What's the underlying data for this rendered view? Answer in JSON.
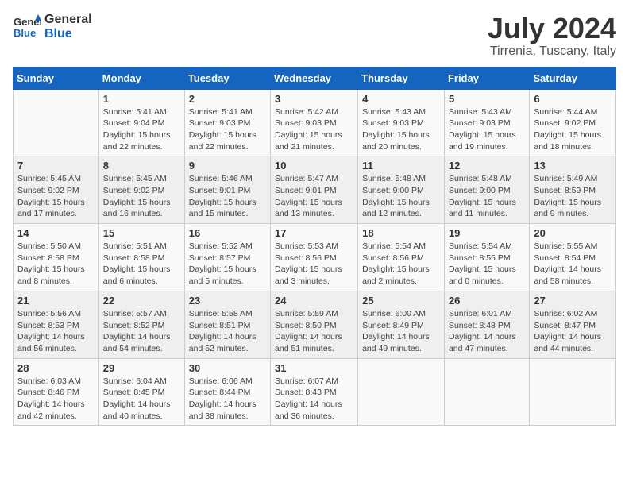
{
  "header": {
    "logo_general": "General",
    "logo_blue": "Blue",
    "month_year": "July 2024",
    "location": "Tirrenia, Tuscany, Italy"
  },
  "calendar": {
    "weekdays": [
      "Sunday",
      "Monday",
      "Tuesday",
      "Wednesday",
      "Thursday",
      "Friday",
      "Saturday"
    ],
    "weeks": [
      [
        {
          "day": "",
          "detail": ""
        },
        {
          "day": "1",
          "detail": "Sunrise: 5:41 AM\nSunset: 9:04 PM\nDaylight: 15 hours\nand 22 minutes."
        },
        {
          "day": "2",
          "detail": "Sunrise: 5:41 AM\nSunset: 9:03 PM\nDaylight: 15 hours\nand 22 minutes."
        },
        {
          "day": "3",
          "detail": "Sunrise: 5:42 AM\nSunset: 9:03 PM\nDaylight: 15 hours\nand 21 minutes."
        },
        {
          "day": "4",
          "detail": "Sunrise: 5:43 AM\nSunset: 9:03 PM\nDaylight: 15 hours\nand 20 minutes."
        },
        {
          "day": "5",
          "detail": "Sunrise: 5:43 AM\nSunset: 9:03 PM\nDaylight: 15 hours\nand 19 minutes."
        },
        {
          "day": "6",
          "detail": "Sunrise: 5:44 AM\nSunset: 9:02 PM\nDaylight: 15 hours\nand 18 minutes."
        }
      ],
      [
        {
          "day": "7",
          "detail": "Sunrise: 5:45 AM\nSunset: 9:02 PM\nDaylight: 15 hours\nand 17 minutes."
        },
        {
          "day": "8",
          "detail": "Sunrise: 5:45 AM\nSunset: 9:02 PM\nDaylight: 15 hours\nand 16 minutes."
        },
        {
          "day": "9",
          "detail": "Sunrise: 5:46 AM\nSunset: 9:01 PM\nDaylight: 15 hours\nand 15 minutes."
        },
        {
          "day": "10",
          "detail": "Sunrise: 5:47 AM\nSunset: 9:01 PM\nDaylight: 15 hours\nand 13 minutes."
        },
        {
          "day": "11",
          "detail": "Sunrise: 5:48 AM\nSunset: 9:00 PM\nDaylight: 15 hours\nand 12 minutes."
        },
        {
          "day": "12",
          "detail": "Sunrise: 5:48 AM\nSunset: 9:00 PM\nDaylight: 15 hours\nand 11 minutes."
        },
        {
          "day": "13",
          "detail": "Sunrise: 5:49 AM\nSunset: 8:59 PM\nDaylight: 15 hours\nand 9 minutes."
        }
      ],
      [
        {
          "day": "14",
          "detail": "Sunrise: 5:50 AM\nSunset: 8:58 PM\nDaylight: 15 hours\nand 8 minutes."
        },
        {
          "day": "15",
          "detail": "Sunrise: 5:51 AM\nSunset: 8:58 PM\nDaylight: 15 hours\nand 6 minutes."
        },
        {
          "day": "16",
          "detail": "Sunrise: 5:52 AM\nSunset: 8:57 PM\nDaylight: 15 hours\nand 5 minutes."
        },
        {
          "day": "17",
          "detail": "Sunrise: 5:53 AM\nSunset: 8:56 PM\nDaylight: 15 hours\nand 3 minutes."
        },
        {
          "day": "18",
          "detail": "Sunrise: 5:54 AM\nSunset: 8:56 PM\nDaylight: 15 hours\nand 2 minutes."
        },
        {
          "day": "19",
          "detail": "Sunrise: 5:54 AM\nSunset: 8:55 PM\nDaylight: 15 hours\nand 0 minutes."
        },
        {
          "day": "20",
          "detail": "Sunrise: 5:55 AM\nSunset: 8:54 PM\nDaylight: 14 hours\nand 58 minutes."
        }
      ],
      [
        {
          "day": "21",
          "detail": "Sunrise: 5:56 AM\nSunset: 8:53 PM\nDaylight: 14 hours\nand 56 minutes."
        },
        {
          "day": "22",
          "detail": "Sunrise: 5:57 AM\nSunset: 8:52 PM\nDaylight: 14 hours\nand 54 minutes."
        },
        {
          "day": "23",
          "detail": "Sunrise: 5:58 AM\nSunset: 8:51 PM\nDaylight: 14 hours\nand 52 minutes."
        },
        {
          "day": "24",
          "detail": "Sunrise: 5:59 AM\nSunset: 8:50 PM\nDaylight: 14 hours\nand 51 minutes."
        },
        {
          "day": "25",
          "detail": "Sunrise: 6:00 AM\nSunset: 8:49 PM\nDaylight: 14 hours\nand 49 minutes."
        },
        {
          "day": "26",
          "detail": "Sunrise: 6:01 AM\nSunset: 8:48 PM\nDaylight: 14 hours\nand 47 minutes."
        },
        {
          "day": "27",
          "detail": "Sunrise: 6:02 AM\nSunset: 8:47 PM\nDaylight: 14 hours\nand 44 minutes."
        }
      ],
      [
        {
          "day": "28",
          "detail": "Sunrise: 6:03 AM\nSunset: 8:46 PM\nDaylight: 14 hours\nand 42 minutes."
        },
        {
          "day": "29",
          "detail": "Sunrise: 6:04 AM\nSunset: 8:45 PM\nDaylight: 14 hours\nand 40 minutes."
        },
        {
          "day": "30",
          "detail": "Sunrise: 6:06 AM\nSunset: 8:44 PM\nDaylight: 14 hours\nand 38 minutes."
        },
        {
          "day": "31",
          "detail": "Sunrise: 6:07 AM\nSunset: 8:43 PM\nDaylight: 14 hours\nand 36 minutes."
        },
        {
          "day": "",
          "detail": ""
        },
        {
          "day": "",
          "detail": ""
        },
        {
          "day": "",
          "detail": ""
        }
      ]
    ]
  }
}
